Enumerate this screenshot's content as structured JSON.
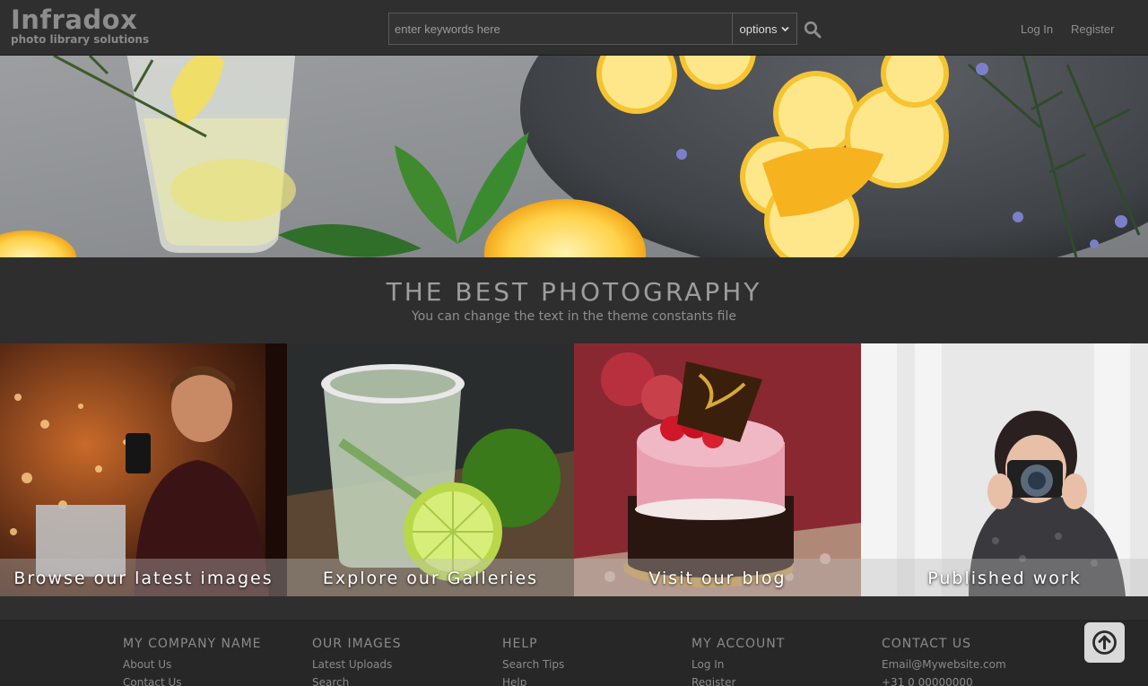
{
  "header": {
    "logo_name": "Infradox",
    "logo_sub": "photo library solutions",
    "search_placeholder": "enter keywords here",
    "options_label": "options",
    "login": "Log In",
    "register": "Register"
  },
  "band": {
    "title": "THE BEST PHOTOGRAPHY",
    "subtitle": "You can change the text in the theme constants file"
  },
  "tiles": [
    {
      "label": "Browse our latest images"
    },
    {
      "label": "Explore our Galleries"
    },
    {
      "label": "Visit our blog"
    },
    {
      "label": "Published work"
    }
  ],
  "footer": {
    "columns": [
      {
        "heading": "MY COMPANY NAME",
        "links": [
          "About Us",
          "Contact Us"
        ]
      },
      {
        "heading": "OUR IMAGES",
        "links": [
          "Latest Uploads",
          "Search"
        ]
      },
      {
        "heading": "HELP",
        "links": [
          "Search Tips",
          "Help"
        ]
      },
      {
        "heading": "MY ACCOUNT",
        "links": [
          "Log In",
          "Register"
        ]
      },
      {
        "heading": "CONTACT US",
        "links": [
          "Email@Mywebsite.com",
          "+31 0 00000000"
        ]
      }
    ]
  },
  "icons": {
    "search": "search-icon",
    "chevron": "chevron-down-icon",
    "back_to_top": "arrow-up-circle-icon"
  }
}
